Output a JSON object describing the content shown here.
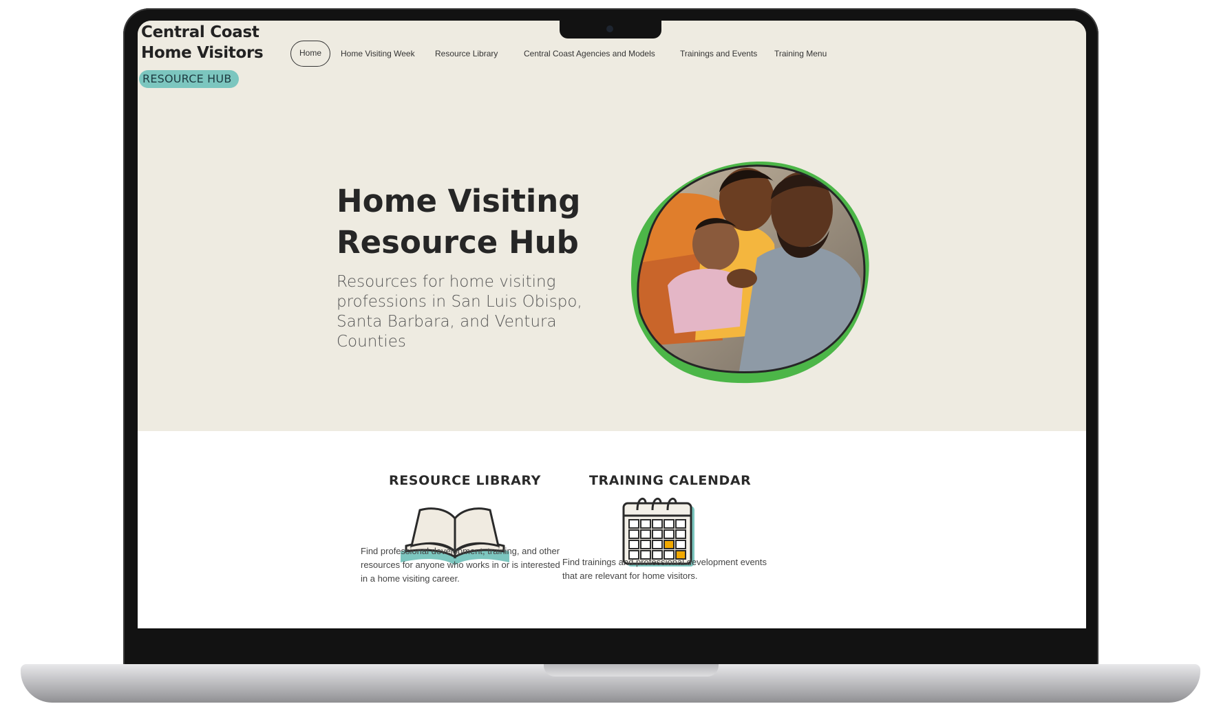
{
  "site": {
    "logo_line1": "Central Coast",
    "logo_line2": "Home Visitors",
    "logo_badge": "RESOURCE HUB"
  },
  "nav": {
    "items": [
      {
        "label": "Home",
        "active": true
      },
      {
        "label": "Home Visiting Week"
      },
      {
        "label": "Resource Library"
      },
      {
        "label": "Central Coast Agencies and Models"
      },
      {
        "label": "Trainings and Events"
      },
      {
        "label": "Training Menu"
      }
    ]
  },
  "hero": {
    "title_line1": "Home Visiting",
    "title_line2": "Resource Hub",
    "subtitle": "Resources for home visiting professions in San Luis Obispo, Santa Barbara, and Ventura Counties"
  },
  "cards": [
    {
      "title": "RESOURCE LIBRARY",
      "icon": "open-book-icon",
      "desc": "Find professional development, training, and other resources for anyone who works in or is interested in a home visiting career."
    },
    {
      "title": "TRAINING CALENDAR",
      "icon": "calendar-icon",
      "desc": "Find trainings and professional development events that are relevant for home visitors."
    }
  ],
  "colors": {
    "hero_bg": "#eeebe1",
    "accent_teal": "#7cc6bf",
    "accent_green": "#4cb648",
    "highlight_orange": "#f2a900"
  }
}
